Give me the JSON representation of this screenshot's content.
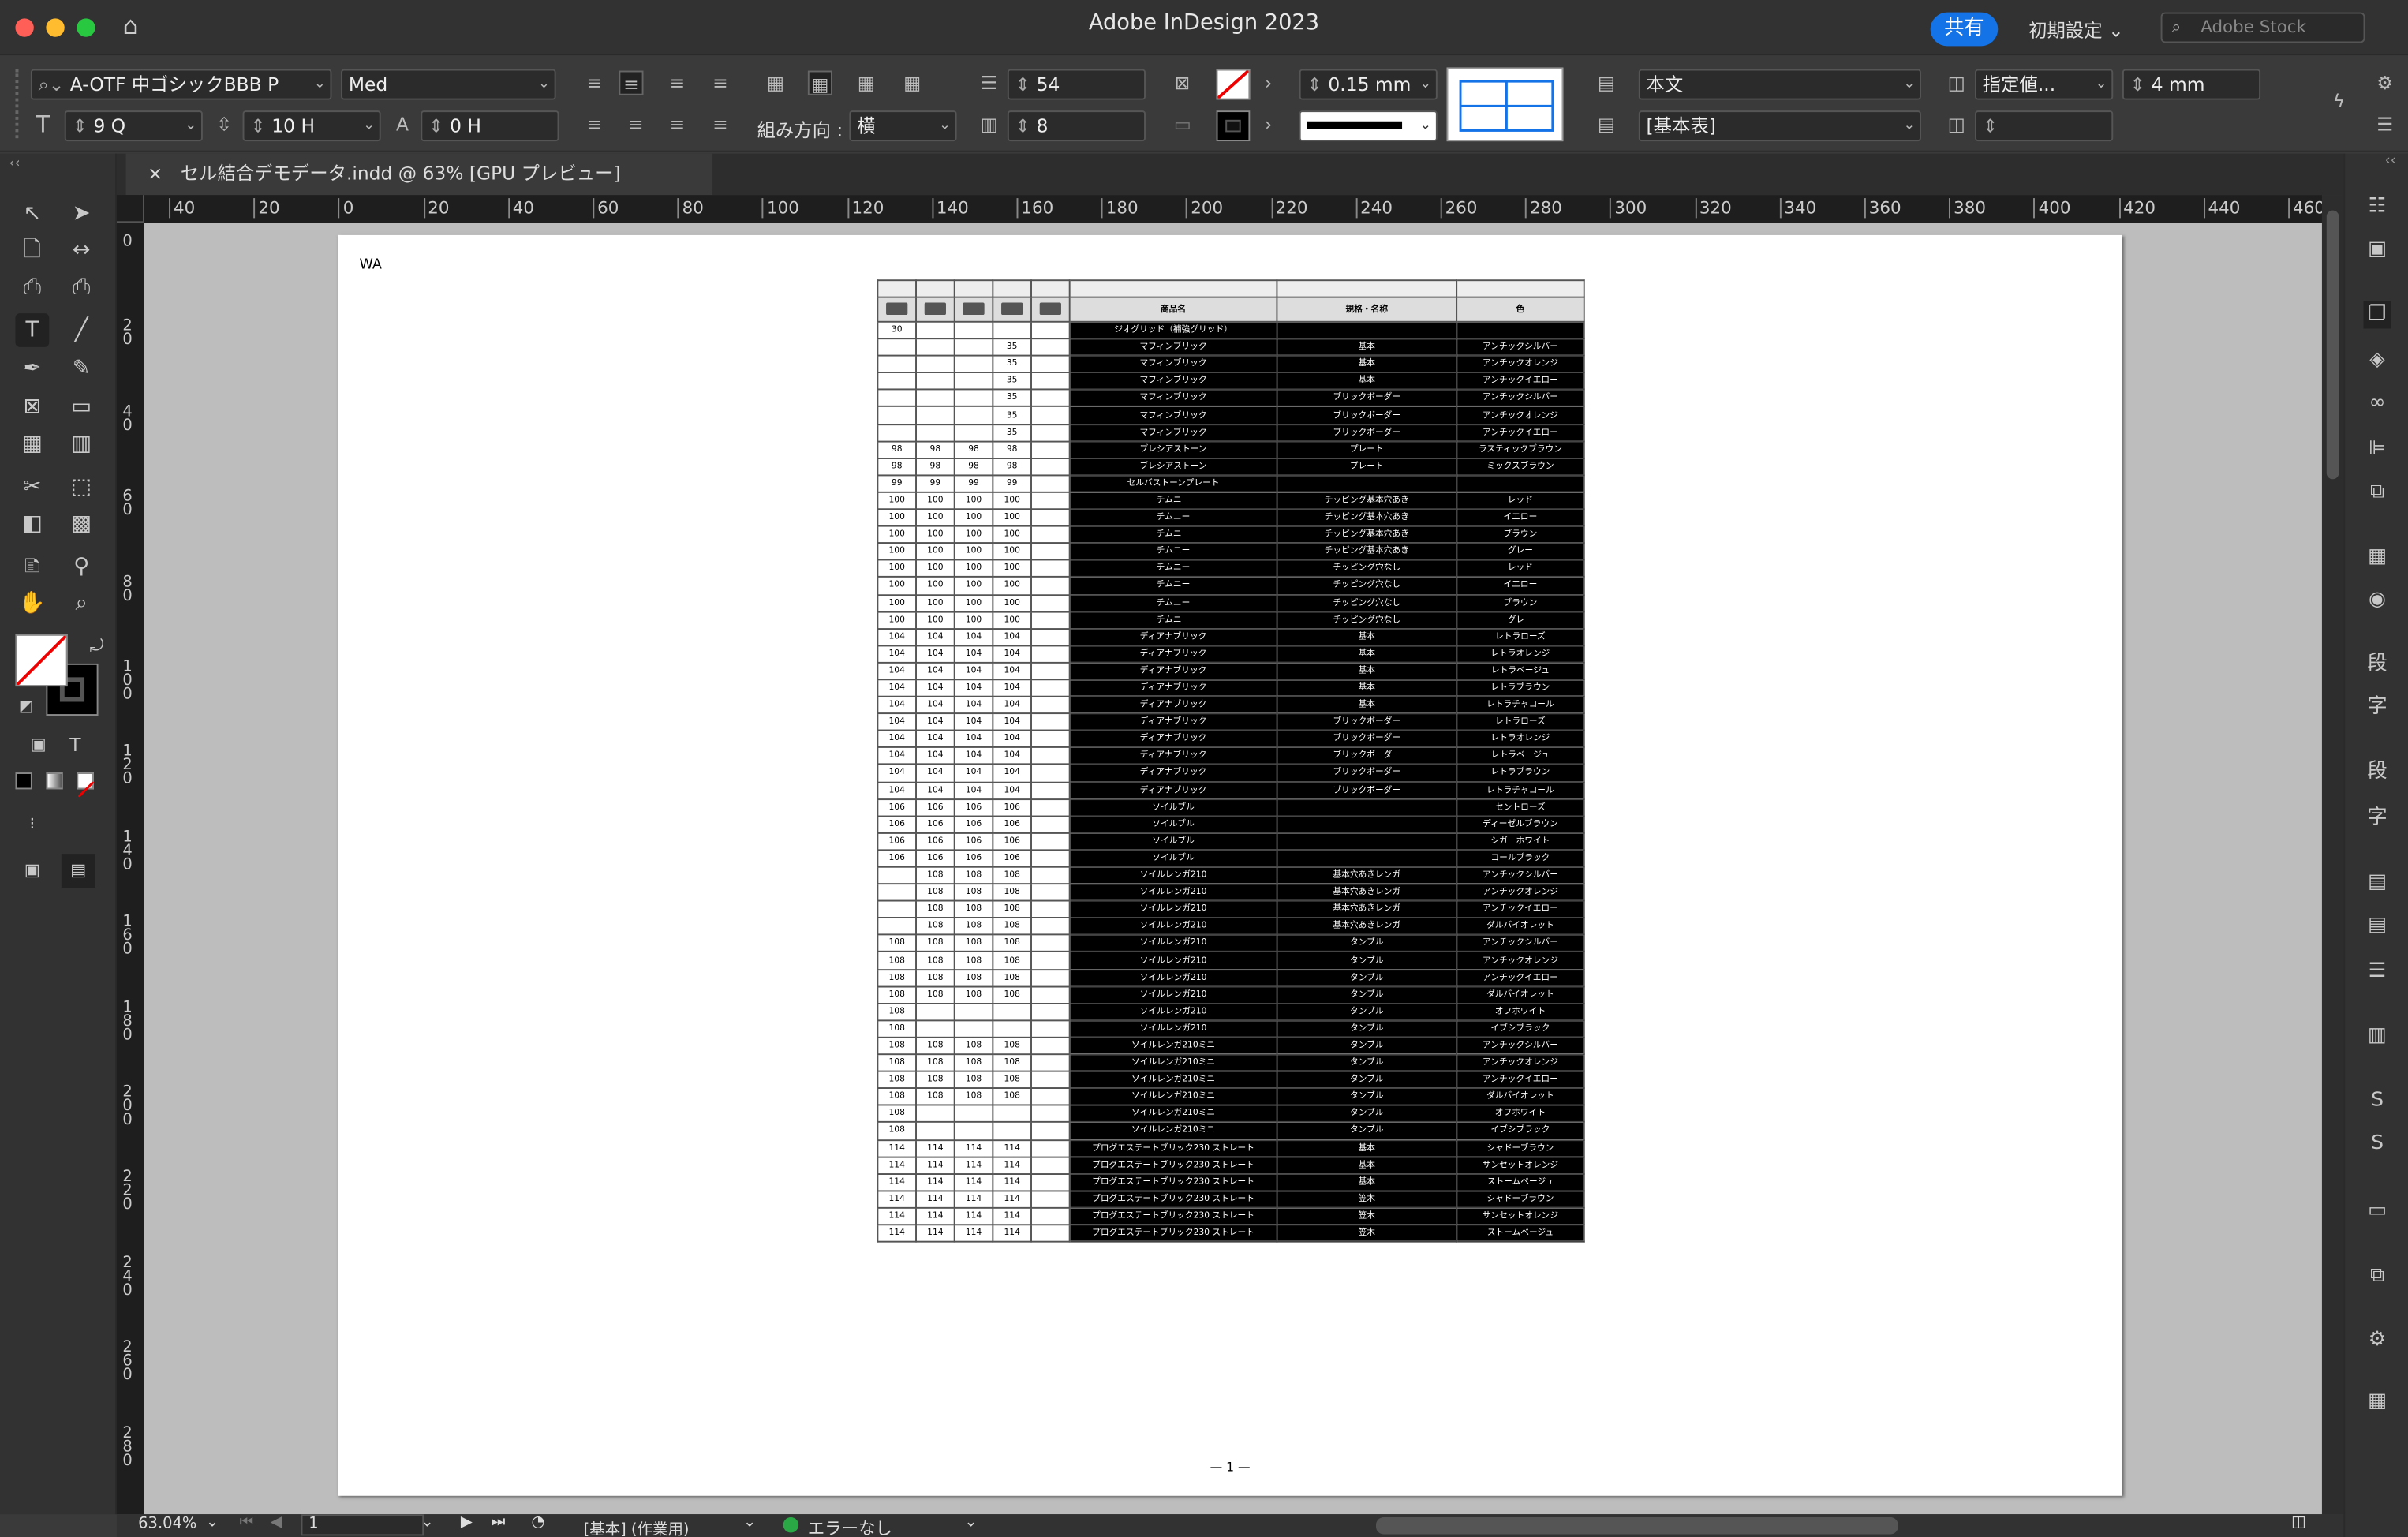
{
  "titlebar": {
    "app_title": "Adobe InDesign 2023",
    "share": "共有",
    "workspace": "初期設定",
    "stock_placeholder": "Adobe Stock"
  },
  "control": {
    "font_family": "A-OTF 中ゴシックBBB P",
    "font_style": "Med",
    "font_size": "9 Q",
    "leading": "10 H",
    "tracking": "0 H",
    "direction_label": "組み方向 :",
    "direction_value": "横",
    "rows": "54",
    "cols": "8",
    "stroke_weight": "0.15 mm",
    "paragraph_style": "本文",
    "table_style": "[基本表]",
    "row_height_mode": "指定値...",
    "row_height": "4 mm"
  },
  "tab": {
    "title": "セル結合デモデータ.indd @ 63% [GPU プレビュー]",
    "close": "×"
  },
  "ruler": {
    "h_labels": [
      "40",
      "20",
      "0",
      "20",
      "40",
      "60",
      "80",
      "100",
      "120",
      "140",
      "160",
      "180",
      "200",
      "220",
      "240",
      "260",
      "280",
      "300",
      "320",
      "340",
      "360",
      "380",
      "400",
      "420",
      "440",
      "460"
    ],
    "v_labels": [
      "0",
      "20",
      "40",
      "60",
      "80",
      "100",
      "120",
      "140",
      "160",
      "180",
      "200",
      "220",
      "240",
      "260",
      "280"
    ]
  },
  "page": {
    "header": "WA",
    "folio": "— 1 —"
  },
  "table": {
    "headers": [
      "商品名",
      "規格・名称",
      "色"
    ],
    "rows": [
      [
        "30",
        "",
        "",
        "",
        "",
        "ジオグリッド（補強グリッド）",
        "",
        ""
      ],
      [
        "",
        "",
        "",
        "35",
        "",
        "マフィンブリック",
        "基本",
        "アンチックシルバー"
      ],
      [
        "",
        "",
        "",
        "35",
        "",
        "マフィンブリック",
        "基本",
        "アンチックオレンジ"
      ],
      [
        "",
        "",
        "",
        "35",
        "",
        "マフィンブリック",
        "基本",
        "アンチックイエロー"
      ],
      [
        "",
        "",
        "",
        "35",
        "",
        "マフィンブリック",
        "ブリックボーダー",
        "アンチックシルバー"
      ],
      [
        "",
        "",
        "",
        "35",
        "",
        "マフィンブリック",
        "ブリックボーダー",
        "アンチックオレンジ"
      ],
      [
        "",
        "",
        "",
        "35",
        "",
        "マフィンブリック",
        "ブリックボーダー",
        "アンチックイエロー"
      ],
      [
        "98",
        "98",
        "98",
        "98",
        "",
        "ブレシアストーン",
        "プレート",
        "ラスティックブラウン"
      ],
      [
        "98",
        "98",
        "98",
        "98",
        "",
        "ブレシアストーン",
        "プレート",
        "ミックスブラウン"
      ],
      [
        "99",
        "99",
        "99",
        "99",
        "",
        "セルバストーンプレート",
        "",
        ""
      ],
      [
        "100",
        "100",
        "100",
        "100",
        "",
        "チムニー",
        "チッピング基本穴あき",
        "レッド"
      ],
      [
        "100",
        "100",
        "100",
        "100",
        "",
        "チムニー",
        "チッピング基本穴あき",
        "イエロー"
      ],
      [
        "100",
        "100",
        "100",
        "100",
        "",
        "チムニー",
        "チッピング基本穴あき",
        "ブラウン"
      ],
      [
        "100",
        "100",
        "100",
        "100",
        "",
        "チムニー",
        "チッピング基本穴あき",
        "グレー"
      ],
      [
        "100",
        "100",
        "100",
        "100",
        "",
        "チムニー",
        "チッピング穴なし",
        "レッド"
      ],
      [
        "100",
        "100",
        "100",
        "100",
        "",
        "チムニー",
        "チッピング穴なし",
        "イエロー"
      ],
      [
        "100",
        "100",
        "100",
        "100",
        "",
        "チムニー",
        "チッピング穴なし",
        "ブラウン"
      ],
      [
        "100",
        "100",
        "100",
        "100",
        "",
        "チムニー",
        "チッピング穴なし",
        "グレー"
      ],
      [
        "104",
        "104",
        "104",
        "104",
        "",
        "ディアナブリック",
        "基本",
        "レトラローズ"
      ],
      [
        "104",
        "104",
        "104",
        "104",
        "",
        "ディアナブリック",
        "基本",
        "レトラオレンジ"
      ],
      [
        "104",
        "104",
        "104",
        "104",
        "",
        "ディアナブリック",
        "基本",
        "レトラベージュ"
      ],
      [
        "104",
        "104",
        "104",
        "104",
        "",
        "ディアナブリック",
        "基本",
        "レトラブラウン"
      ],
      [
        "104",
        "104",
        "104",
        "104",
        "",
        "ディアナブリック",
        "基本",
        "レトラチャコール"
      ],
      [
        "104",
        "104",
        "104",
        "104",
        "",
        "ディアナブリック",
        "ブリックボーダー",
        "レトラローズ"
      ],
      [
        "104",
        "104",
        "104",
        "104",
        "",
        "ディアナブリック",
        "ブリックボーダー",
        "レトラオレンジ"
      ],
      [
        "104",
        "104",
        "104",
        "104",
        "",
        "ディアナブリック",
        "ブリックボーダー",
        "レトラベージュ"
      ],
      [
        "104",
        "104",
        "104",
        "104",
        "",
        "ディアナブリック",
        "ブリックボーダー",
        "レトラブラウン"
      ],
      [
        "104",
        "104",
        "104",
        "104",
        "",
        "ディアナブリック",
        "ブリックボーダー",
        "レトラチャコール"
      ],
      [
        "106",
        "106",
        "106",
        "106",
        "",
        "ソイルブル",
        "",
        "セントローズ"
      ],
      [
        "106",
        "106",
        "106",
        "106",
        "",
        "ソイルブル",
        "",
        "ディーゼルブラウン"
      ],
      [
        "106",
        "106",
        "106",
        "106",
        "",
        "ソイルブル",
        "",
        "シガーホワイト"
      ],
      [
        "106",
        "106",
        "106",
        "106",
        "",
        "ソイルブル",
        "",
        "コールブラック"
      ],
      [
        "",
        "108",
        "108",
        "108",
        "",
        "ソイルレンガ210",
        "基本穴あきレンガ",
        "アンチックシルバー"
      ],
      [
        "",
        "108",
        "108",
        "108",
        "",
        "ソイルレンガ210",
        "基本穴あきレンガ",
        "アンチックオレンジ"
      ],
      [
        "",
        "108",
        "108",
        "108",
        "",
        "ソイルレンガ210",
        "基本穴あきレンガ",
        "アンチックイエロー"
      ],
      [
        "",
        "108",
        "108",
        "108",
        "",
        "ソイルレンガ210",
        "基本穴あきレンガ",
        "ダルバイオレット"
      ],
      [
        "108",
        "108",
        "108",
        "108",
        "",
        "ソイルレンガ210",
        "タンブル",
        "アンチックシルバー"
      ],
      [
        "108",
        "108",
        "108",
        "108",
        "",
        "ソイルレンガ210",
        "タンブル",
        "アンチックオレンジ"
      ],
      [
        "108",
        "108",
        "108",
        "108",
        "",
        "ソイルレンガ210",
        "タンブル",
        "アンチックイエロー"
      ],
      [
        "108",
        "108",
        "108",
        "108",
        "",
        "ソイルレンガ210",
        "タンブル",
        "ダルバイオレット"
      ],
      [
        "108",
        "",
        "",
        "",
        "",
        "ソイルレンガ210",
        "タンブル",
        "オフホワイト"
      ],
      [
        "108",
        "",
        "",
        "",
        "",
        "ソイルレンガ210",
        "タンブル",
        "イブシブラック"
      ],
      [
        "108",
        "108",
        "108",
        "108",
        "",
        "ソイルレンガ210ミニ",
        "タンブル",
        "アンチックシルバー"
      ],
      [
        "108",
        "108",
        "108",
        "108",
        "",
        "ソイルレンガ210ミニ",
        "タンブル",
        "アンチックオレンジ"
      ],
      [
        "108",
        "108",
        "108",
        "108",
        "",
        "ソイルレンガ210ミニ",
        "タンブル",
        "アンチックイエロー"
      ],
      [
        "108",
        "108",
        "108",
        "108",
        "",
        "ソイルレンガ210ミニ",
        "タンブル",
        "ダルバイオレット"
      ],
      [
        "108",
        "",
        "",
        "",
        "",
        "ソイルレンガ210ミニ",
        "タンブル",
        "オフホワイト"
      ],
      [
        "108",
        "",
        "",
        "",
        "",
        "ソイルレンガ210ミニ",
        "タンブル",
        "イブシブラック"
      ],
      [
        "114",
        "114",
        "114",
        "114",
        "",
        "プログエステートブリック230 ストレート",
        "基本",
        "シャドーブラウン"
      ],
      [
        "114",
        "114",
        "114",
        "114",
        "",
        "プログエステートブリック230 ストレート",
        "基本",
        "サンセットオレンジ"
      ],
      [
        "114",
        "114",
        "114",
        "114",
        "",
        "プログエステートブリック230 ストレート",
        "基本",
        "ストームベージュ"
      ],
      [
        "114",
        "114",
        "114",
        "114",
        "",
        "プログエステートブリック230 ストレート",
        "笠木",
        "シャドーブラウン"
      ],
      [
        "114",
        "114",
        "114",
        "114",
        "",
        "プログエステートブリック230 ストレート",
        "笠木",
        "サンセットオレンジ"
      ],
      [
        "114",
        "114",
        "114",
        "114",
        "",
        "プログエステートブリック230 ストレート",
        "笠木",
        "ストームベージュ"
      ]
    ]
  },
  "status": {
    "zoom": "63.04%",
    "page": "1",
    "master": "[基本] (作業用)",
    "preflight": "エラーなし"
  }
}
